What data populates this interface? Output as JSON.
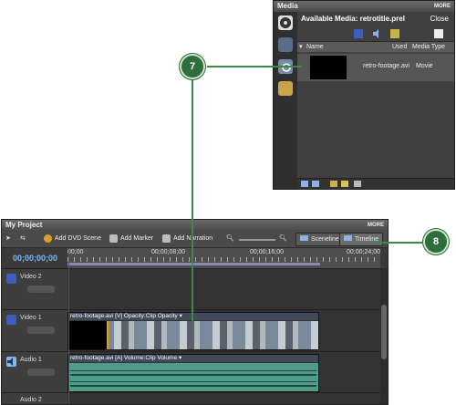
{
  "media_panel": {
    "title": "Media",
    "more": "MORE",
    "available_label": "Available Media: retrotitle.prel",
    "close_label": "Close",
    "columns": {
      "name": "Name",
      "used": "Used",
      "type": "Media Type"
    },
    "items": [
      {
        "name": "retro-footage.avi",
        "type": "Movie"
      }
    ],
    "icons": [
      "film-icon",
      "scene-icon",
      "magnify-icon",
      "titles-icon"
    ]
  },
  "project_panel": {
    "title": "My Project",
    "more": "MORE",
    "toolbar": {
      "add_dvd_scene": "Add DVD Scene",
      "add_marker": "Add Marker",
      "add_narration": "Add Narration",
      "sceneline": "Sceneline",
      "timeline": "Timeline"
    },
    "timecode": "00;00;00;00",
    "ruler_labels": [
      "00;00",
      "00;00;08;00",
      "00;00;16;00",
      "00;00;24;00"
    ],
    "tracks": [
      {
        "name": "Video 2"
      },
      {
        "name": "Video 1",
        "clip_label": "retro-footage.avi [V] Opacity:Clip Opacity ▾"
      },
      {
        "name": "Audio 1",
        "clip_label": "retro-footage.avi [A] Volume:Clip Volume ▾"
      },
      {
        "name": "Audio 2"
      }
    ]
  },
  "callouts": {
    "seven": "7",
    "eight": "8"
  },
  "colors": {
    "accent": "#2e6e3c",
    "playhead": "#cc2222",
    "timecode": "#7ab6ff",
    "audio_clip": "#4f9c8b"
  }
}
